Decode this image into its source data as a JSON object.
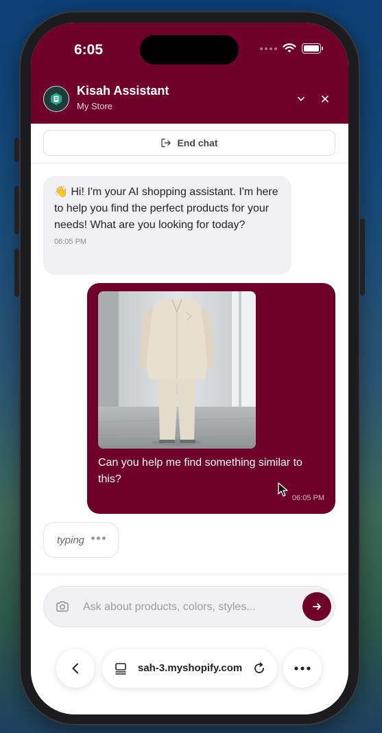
{
  "status_bar": {
    "time": "6:05"
  },
  "header": {
    "title": "Kisah Assistant",
    "subtitle": "My Store",
    "color": "#6f0029"
  },
  "end_chat": {
    "label": "End chat"
  },
  "messages": {
    "bot": {
      "emoji": "👋",
      "text": "Hi! I'm your AI shopping assistant. I'm here to help you find the perfect products for your needs! What are you looking for today?",
      "time": "06:05 PM"
    },
    "user": {
      "text": "Can you help me find something similar to this?",
      "time": "06:05 PM"
    }
  },
  "typing": {
    "label": "typing"
  },
  "composer": {
    "placeholder": "Ask about products, colors, styles...",
    "value": ""
  },
  "browser": {
    "url": "sah-3.myshopify.com"
  }
}
